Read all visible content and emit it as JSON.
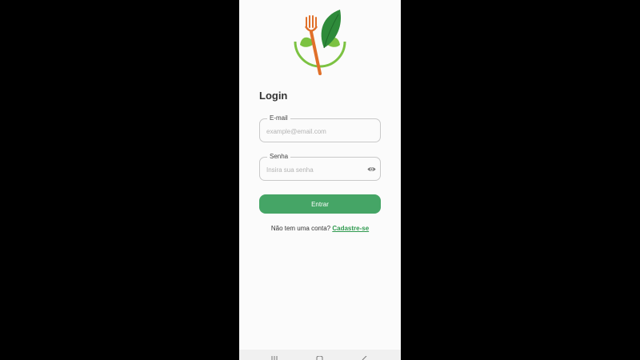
{
  "login": {
    "title": "Login",
    "email_label": "E-mail",
    "email_placeholder": "example@email.com",
    "senha_label": "Senha",
    "senha_placeholder": "Insira sua senha",
    "submit_label": "Entrar",
    "no_account_text": "Não tem uma conta?",
    "signup_link": "Cadastre-se"
  },
  "icons": {
    "logo": "fork-leaf-logo-icon",
    "password_toggle": "eye-icon",
    "nav": [
      "recent-apps-icon",
      "home-icon",
      "back-icon"
    ]
  },
  "colors": {
    "primary": "#45a566",
    "link": "#2f9a4f",
    "fork": "#e0702a",
    "leaf_dark": "#2e8b3a",
    "leaf_light": "#7cc242"
  }
}
